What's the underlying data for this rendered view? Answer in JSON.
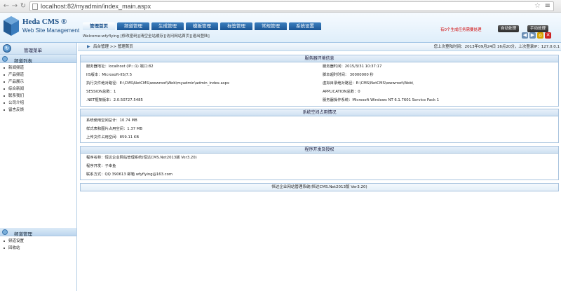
{
  "browser": {
    "url": "localhost:82/myadmin/index_main.aspx"
  },
  "header": {
    "logo_title": "Heda CMS ®",
    "logo_subtitle": "Web Site Management",
    "nav_tabs": [
      {
        "label": "管理首页",
        "active": true
      },
      {
        "label": "频道管理",
        "active": false
      },
      {
        "label": "生成管理",
        "active": false
      },
      {
        "label": "模板管理",
        "active": false
      },
      {
        "label": "标签管理",
        "active": false
      },
      {
        "label": "常规管理",
        "active": false
      },
      {
        "label": "系统设置",
        "active": false
      }
    ],
    "welcome": "Welcome:wfyflying [修改密码][清空全站缓存][访问网站首页][退出登陆]",
    "tasks_note": "有0个生成任务需要处理",
    "auto_button": "自动处理",
    "manual_button": "手动处理"
  },
  "sidebar": {
    "title": "管理菜单",
    "group1": {
      "title": "频道列表",
      "items": [
        "新闻频道",
        "产品频道",
        "产品展示",
        "综合新闻",
        "联系我们",
        "公司介绍",
        "留言反馈"
      ]
    },
    "group2": {
      "title": "频道管理",
      "items": [
        "频道设置",
        "回收站"
      ]
    }
  },
  "main": {
    "breadcrumb": "后台管理 >> 管理首页",
    "last_login": "您上次登陆时间：2013年09月24日 16点20分，上次登录IP：127.0.0.1",
    "server_section": {
      "title": "服务器环境信息",
      "rows": [
        {
          "left": "服务器地址：localhost (IP:::1) 端口:82",
          "right": "服务器时间：2015/3/31 10:37:17"
        },
        {
          "left": "IIS版本：Microsoft-IIS/7.5",
          "right": "脚本超时时间： 30000000 秒"
        },
        {
          "left": "执行文件绝对路径：E:\\CMS\\NetCMS\\wwwroot\\Web\\myadmin\\admin_index.aspx",
          "right": "虚拟目录绝对路径：E:\\CMS\\NetCMS\\wwwroot\\Web\\"
        },
        {
          "left": "SESSION总数：1",
          "right": "APPLICATION总数：0"
        },
        {
          "left": ".NET框架版本：2.0.50727.5485",
          "right": "服务器操作系统：Microsoft Windows NT 6.1.7601 Service Pack 1"
        }
      ]
    },
    "space_section": {
      "title": "系统空间占用情况",
      "rows": [
        "系统使用空间总计：10.74  MB",
        "样式表和图片占用空间：1.37  MB",
        "上传文件占用空间：859.11  KB"
      ]
    },
    "dev_section": {
      "title": "程序开发及授权",
      "rows": [
        "程序名称：恒达企业网站管理系统(恒达CMS.Net2013版 Ver3.20)",
        "程序开发：子幸鱼",
        "联系方式：QQ 390613 邮箱 wfyflying@163.com"
      ]
    },
    "footer": "恒达企业网站管理系统(恒达CMS.Net2013版 Ver3.20)"
  }
}
